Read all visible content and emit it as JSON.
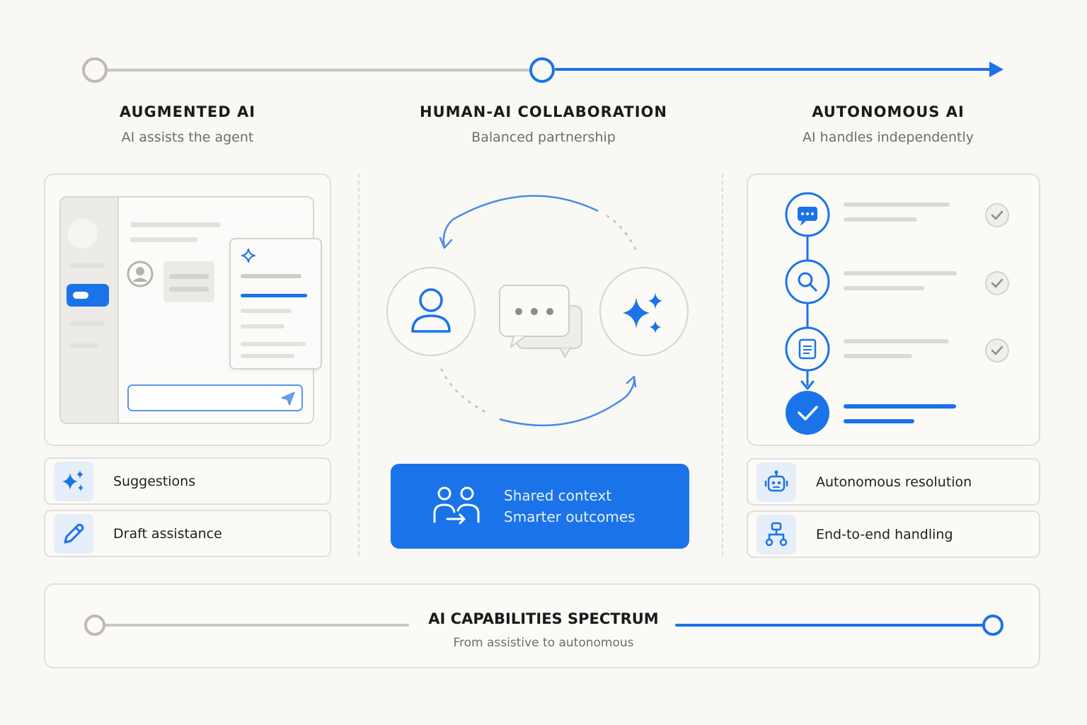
{
  "stages": [
    {
      "title": "AUGMENTED AI",
      "subtitle": "AI assists the agent"
    },
    {
      "title": "HUMAN-AI COLLABORATION",
      "subtitle": "Balanced partnership"
    },
    {
      "title": "AUTONOMOUS AI",
      "subtitle": "AI handles independently"
    }
  ],
  "augmented": {
    "features": [
      {
        "label": "Suggestions",
        "icon": "sparkles-icon"
      },
      {
        "label": "Draft assistance",
        "icon": "pencil-icon"
      }
    ]
  },
  "collaboration": {
    "cta_line1": "Shared context",
    "cta_line2": "Smarter outcomes"
  },
  "autonomous": {
    "steps": [
      "chat-bubble-icon",
      "search-icon",
      "document-icon",
      "check-icon"
    ],
    "features": [
      {
        "label": "Autonomous resolution",
        "icon": "robot-icon"
      },
      {
        "label": "End-to-end handling",
        "icon": "workflow-icon"
      }
    ]
  },
  "spectrum": {
    "title": "AI CAPABILITIES SPECTRUM",
    "subtitle": "From assistive to autonomous"
  },
  "colors": {
    "accent": "#1a73e8",
    "muted_line": "#c9c7c3",
    "background": "#faf8f4"
  }
}
